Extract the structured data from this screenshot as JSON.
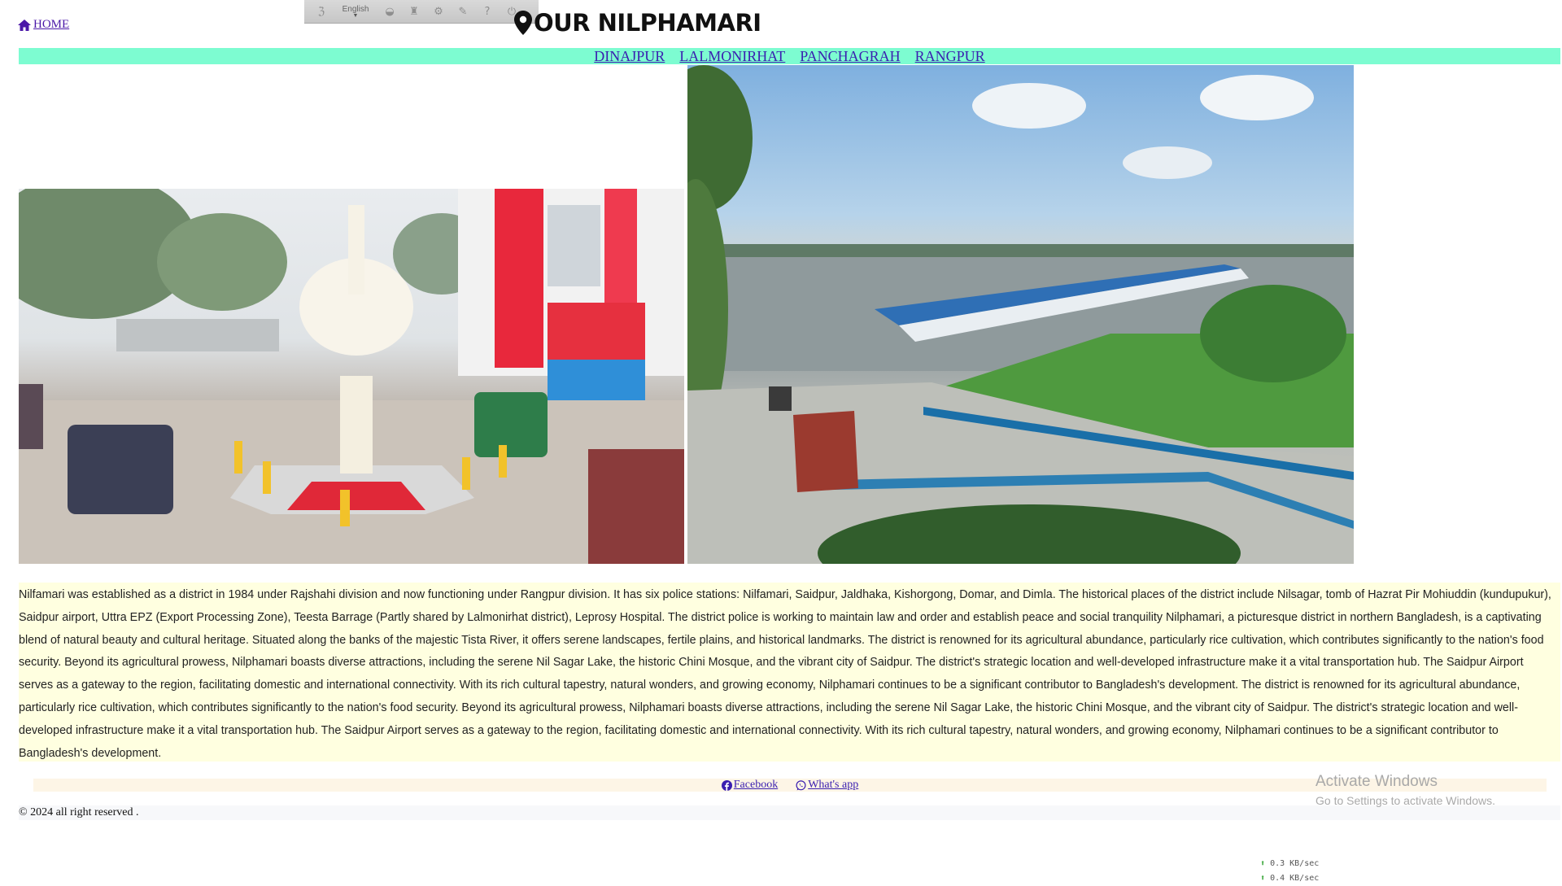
{
  "header": {
    "home_label": "HOME",
    "site_title": "OUR NILPHAMARI",
    "toolbar": {
      "language": "English"
    }
  },
  "nav": {
    "links": [
      "DINAJPUR",
      "LALMONIRHAT",
      "PANCHAGRAH",
      "RANGPUR"
    ]
  },
  "description": "Nilfamari was established as a district in 1984 under Rajshahi division and now functioning under Rangpur division. It has six police stations: Nilfamari, Saidpur, Jaldhaka, Kishorgong, Domar, and Dimla. The historical places of the district include Nilsagar, tomb of Hazrat Pir Mohiuddin (kundupukur), Saidpur airport, Uttra EPZ (Export Processing Zone), Teesta Barrage (Partly shared by Lalmonirhat district), Leprosy Hospital. The district police is working to maintain law and order and establish peace and social tranquility Nilphamari, a picturesque district in northern Bangladesh, is a captivating blend of natural beauty and cultural heritage. Situated along the banks of the majestic Tista River, it offers serene landscapes, fertile plains, and historical landmarks. The district is renowned for its agricultural abundance, particularly rice cultivation, which contributes significantly to the nation's food security. Beyond its agricultural prowess, Nilphamari boasts diverse attractions, including the serene Nil Sagar Lake, the historic Chini Mosque, and the vibrant city of Saidpur. The district's strategic location and well-developed infrastructure make it a vital transportation hub. The Saidpur Airport serves as a gateway to the region, facilitating domestic and international connectivity. With its rich cultural tapestry, natural wonders, and growing economy, Nilphamari continues to be a significant contributor to Bangladesh's development. The district is renowned for its agricultural abundance, particularly rice cultivation, which contributes significantly to the nation's food security. Beyond its agricultural prowess, Nilphamari boasts diverse attractions, including the serene Nil Sagar Lake, the historic Chini Mosque, and the vibrant city of Saidpur. The district's strategic location and well-developed infrastructure make it a vital transportation hub. The Saidpur Airport serves as a gateway to the region, facilitating domestic and international connectivity. With its rich cultural tapestry, natural wonders, and growing economy, Nilphamari continues to be a significant contributor to Bangladesh's development.",
  "social": {
    "facebook": "Facebook",
    "whatsapp": "What's app"
  },
  "footer": {
    "copyright": "© 2024 all right reserved ."
  },
  "overlay": {
    "activate_title": "Activate Windows",
    "activate_sub": "Go to Settings to activate Windows.",
    "upload_speed": "0.3 KB/sec",
    "download_speed": "0.4 KB/sec"
  },
  "colors": {
    "nav_bg": "#7dfcd1",
    "desc_bg": "#ffffe0",
    "social_bg": "#fdf5e6",
    "link": "#3a1fb0"
  }
}
